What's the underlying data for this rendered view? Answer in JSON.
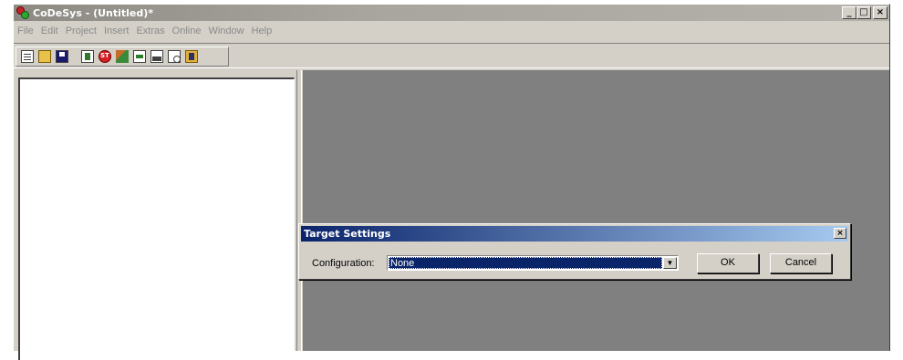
{
  "window": {
    "title": "CoDeSys - (Untitled)*",
    "controls": {
      "minimize": "_",
      "maximize": "□",
      "close": "×"
    }
  },
  "menu": [
    "File",
    "Edit",
    "Project",
    "Insert",
    "Extras",
    "Online",
    "Window",
    "Help"
  ],
  "toolbar": {
    "icons": [
      "new-icon",
      "open-icon",
      "save-icon",
      "login-icon",
      "stop-icon",
      "run-icon",
      "single-cycle-icon",
      "print-icon",
      "print-preview-icon",
      "help-icon"
    ]
  },
  "dialog": {
    "title": "Target Settings",
    "close": "×",
    "configuration_label": "Configuration:",
    "configuration_value": "None",
    "dropdown_arrow": "▼",
    "ok_label": "OK",
    "cancel_label": "Cancel"
  },
  "colors": {
    "dialog_title_start": "#0a246a",
    "dialog_title_end": "#a6caf0",
    "mdi_background": "#808080",
    "face": "#d4d0c8"
  }
}
